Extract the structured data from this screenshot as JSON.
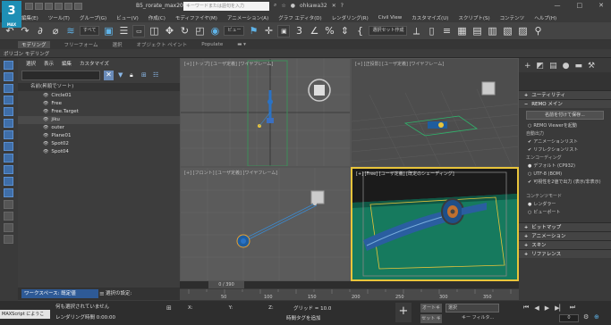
{
  "app": {
    "logo_text": "3",
    "logo_sub": "MAX",
    "doc_title": "B5_rorate_max2012...",
    "search_placeholder": "キーワードまたは語句を入力",
    "user_name": "ohkawa32",
    "window_controls": [
      "—",
      "□",
      "✕"
    ]
  },
  "menu": {
    "items": [
      "編集(E)",
      "ツール(T)",
      "グループ(G)",
      "ビュー(V)",
      "作成(C)",
      "モディファイヤ(M)",
      "アニメーション(A)",
      "グラフ エディタ(D)",
      "レンダリング(R)",
      "Civil View",
      "カスタマイズ(U)",
      "スクリプト(S)",
      "コンテンツ",
      "ヘルプ(H)"
    ]
  },
  "toolbar": {
    "filter_dropdown": "すべて",
    "view_dropdown": "ビュー",
    "selection_set_dropdown": "選択セット作成"
  },
  "ribbon": {
    "tabs": [
      "モデリング",
      "フリーフォーム",
      "選択",
      "オブジェクト ペイント",
      "Populate"
    ],
    "active_tab": "モデリング",
    "sub_label": "ポリゴン モデリング"
  },
  "scene_explorer": {
    "menu": [
      "選択",
      "表示",
      "編集",
      "カスタマイズ"
    ],
    "column_header": "名前(昇順でソート)",
    "items": [
      {
        "name": "Circle01",
        "selected": false
      },
      {
        "name": "Free",
        "selected": false
      },
      {
        "name": "Free.Target",
        "selected": false
      },
      {
        "name": "jiku",
        "selected": true
      },
      {
        "name": "outer",
        "selected": false
      },
      {
        "name": "Plane01",
        "selected": false
      },
      {
        "name": "Spot02",
        "selected": false
      },
      {
        "name": "Spot04",
        "selected": false
      }
    ],
    "workspace_label": "ワークスペース: 既定値",
    "selection_settings": "選択の設定:"
  },
  "viewports": {
    "top_label": "[+] [トップ] [ユーザ定義] [ワイヤフレーム]",
    "persp_label": "[+] [正投影] [ユーザ定義] [ワイヤフレーム]",
    "front_label": "[+] [フロント] [ユーザ定義] [ワイヤフレーム]",
    "render_label": "[+] [Free] [ユーザ定義] [既定のシェーディング]"
  },
  "command_panel": {
    "utility_rollout": "ユーティリティ",
    "remo_rollout": "REMO メイン",
    "save_button": "名前を付けて保存...",
    "remo_viewer": "REMO Viewerを起動",
    "auto_output": "自動出力",
    "anim_list": "アニメーションリスト",
    "reflection_list": "リフレクションリスト",
    "encoding": "エンコーディング",
    "default_cp932": "デフォルト (CP932)",
    "utf8_bom": "UTF-8 (BOM)",
    "show_vectors": "可視性を2値で出力 (表示/非表示)",
    "content_mode": "コンテンツモード",
    "render": "レンダラー",
    "viewport": "ビューポート",
    "bottom_rollouts": [
      "ビットマップ",
      "アニメーション",
      "スキン",
      "リファレンス"
    ]
  },
  "timeline": {
    "frame_display": "0 / 390",
    "tick_labels": [
      "50",
      "100",
      "150",
      "200",
      "250",
      "300",
      "350"
    ]
  },
  "status": {
    "maxscript": "MAXScript にようこ",
    "line1": "何も選択されていません",
    "line2": "レンダリング時間 0:00:00",
    "x_label": "X:",
    "y_label": "Y:",
    "z_label": "Z:",
    "grid": "グリッド = 10.0",
    "add_time_tag": "時間タグを追加",
    "auto_key": "オートキー",
    "selection_dropdown": "選択",
    "set_key": "セット キー",
    "key_filters": "キー フィルタ...",
    "frame": "0"
  }
}
